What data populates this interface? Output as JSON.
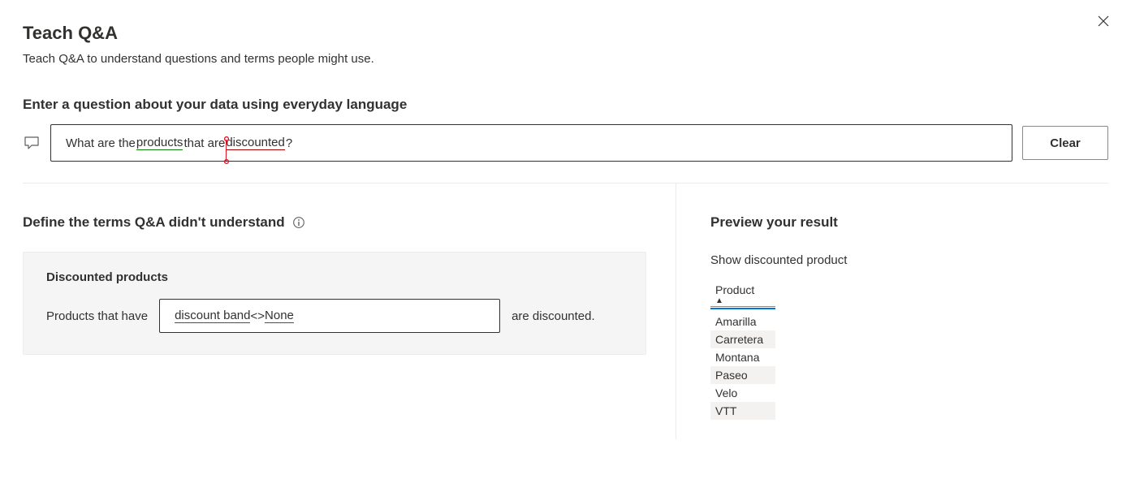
{
  "header": {
    "title": "Teach Q&A",
    "subtitle": "Teach Q&A to understand questions and terms people might use."
  },
  "question": {
    "label": "Enter a question about your data using everyday language",
    "tokens": {
      "t1": "What are the ",
      "products": "products",
      "t2": " that are ",
      "discounted": "discounted",
      "t3": "?"
    },
    "clear": "Clear"
  },
  "define": {
    "heading": "Define the terms Q&A didn't understand",
    "term": "Discounted products",
    "prefix": "Products that have",
    "suffix": "are discounted.",
    "input": {
      "t1": "discount band",
      "t2": " <> ",
      "t3": "None"
    }
  },
  "preview": {
    "heading": "Preview your result",
    "label": "Show discounted product",
    "column": "Product",
    "rows": [
      "Amarilla",
      "Carretera",
      "Montana",
      "Paseo",
      "Velo",
      "VTT"
    ]
  }
}
